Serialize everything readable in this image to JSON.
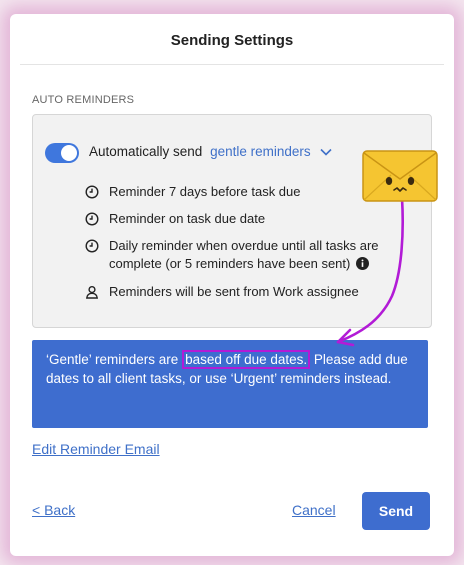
{
  "dialog": {
    "title": "Sending Settings"
  },
  "auto_reminders": {
    "section_label": "AUTO REMINDERS",
    "toggle_on": true,
    "auto_send_label": "Automatically send",
    "reminder_type": "gentle reminders",
    "items": [
      {
        "icon": "clock-icon",
        "text": "Reminder 7 days before task due"
      },
      {
        "icon": "clock-icon",
        "text": "Reminder on task due date"
      },
      {
        "icon": "clock-icon",
        "text": "Daily reminder when overdue until all tasks are complete (or 5 reminders have been sent)"
      },
      {
        "icon": "person-icon",
        "text": "Reminders will be sent from Work assignee"
      }
    ]
  },
  "banner": {
    "before": "‘Gentle’ reminders are ",
    "highlight": "based off due dates.",
    "after": " Please add due dates to all client tasks, or use ‘Urgent’ reminders instead."
  },
  "links": {
    "edit_email": "Edit Reminder Email",
    "back": "< Back",
    "cancel": "Cancel"
  },
  "buttons": {
    "send": "Send"
  },
  "colors": {
    "accent": "#3e6dcf",
    "link": "#3f70c8",
    "annotation": "#b21bd6",
    "envelope": "#f5c531"
  }
}
